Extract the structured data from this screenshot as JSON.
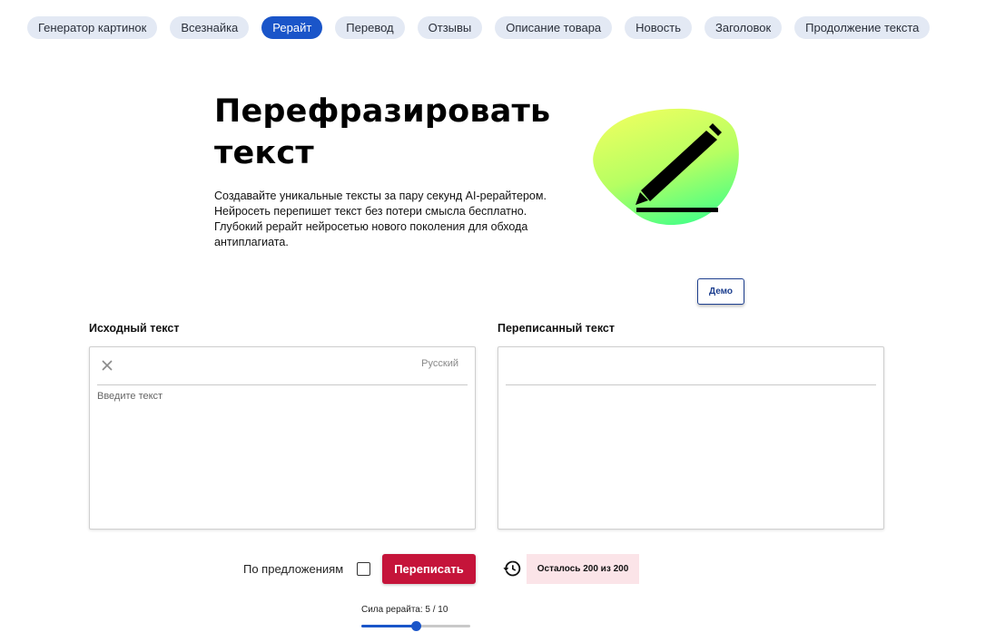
{
  "nav": {
    "tabs": [
      {
        "label": "Генератор картинок",
        "active": false
      },
      {
        "label": "Всезнайка",
        "active": false
      },
      {
        "label": "Рерайт",
        "active": true
      },
      {
        "label": "Перевод",
        "active": false
      },
      {
        "label": "Отзывы",
        "active": false
      },
      {
        "label": "Описание товара",
        "active": false
      },
      {
        "label": "Новость",
        "active": false
      },
      {
        "label": "Заголовок",
        "active": false
      },
      {
        "label": "Продолжение текста",
        "active": false
      }
    ]
  },
  "hero": {
    "title_line1": "Перефразировать",
    "title_line2": "текст",
    "description_lines": [
      "Создавайте уникальные тексты за пару секунд AI-рерайтером.",
      "Нейросеть перепишет текст без потери смысла бесплатно.",
      "Глубокий рерайт нейросетью нового поколения для обхода",
      "антиплагиата."
    ],
    "illustration_icon": "pencil-icon"
  },
  "demo_label": "Демо",
  "source": {
    "label": "Исходный текст",
    "language": "Русский",
    "placeholder": "Введите текст",
    "value": ""
  },
  "result": {
    "label": "Переписанный текст"
  },
  "controls": {
    "by_sentence_label": "По предложениям",
    "by_sentence_checked": false,
    "rewrite_label": "Переписать",
    "remaining_text": "Осталось 200 из 200"
  },
  "strength": {
    "label": "Сила рерайта: 5 / 10",
    "value": 5,
    "max": 10
  },
  "colors": {
    "accent": "#1a55c9",
    "primary_button": "#c5143a",
    "badge_bg": "#fbe4e8"
  }
}
